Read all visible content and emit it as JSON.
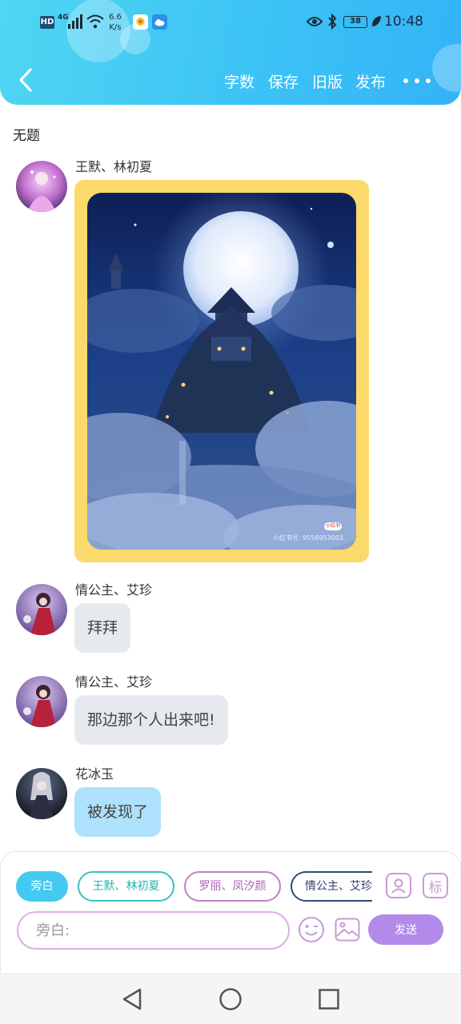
{
  "status_bar": {
    "hd": "HD",
    "network": "4G",
    "speed_value": "6.6",
    "speed_unit": "K/s",
    "battery": "38",
    "time": "10:48"
  },
  "toolbar": {
    "word_count": "字数",
    "save": "保存",
    "old_version": "旧版",
    "publish": "发布"
  },
  "document": {
    "title": "无题"
  },
  "messages": [
    {
      "speaker": "王默、林初夏",
      "type": "image",
      "watermark_badge": "小红书",
      "watermark": "小红书号: 9556953003"
    },
    {
      "speaker": "情公主、艾珍",
      "type": "text",
      "text": "拜拜"
    },
    {
      "speaker": "情公主、艾珍",
      "type": "text",
      "text": "那边那个人出来吧!"
    },
    {
      "speaker": "花冰玉",
      "type": "text",
      "text": "被发现了"
    }
  ],
  "composer": {
    "roles": [
      "旁白",
      "王默、林初夏",
      "罗丽、凤汐颜",
      "情公主、艾珍"
    ],
    "tag_label": "标",
    "placeholder": "旁白:",
    "send": "发送"
  },
  "colors": {
    "header": "#3cc3f5",
    "image_frame": "#fbd96b",
    "send_button": "#b389ea",
    "bubble_gray": "#e6e9ee",
    "bubble_blue": "#aee1fb"
  }
}
